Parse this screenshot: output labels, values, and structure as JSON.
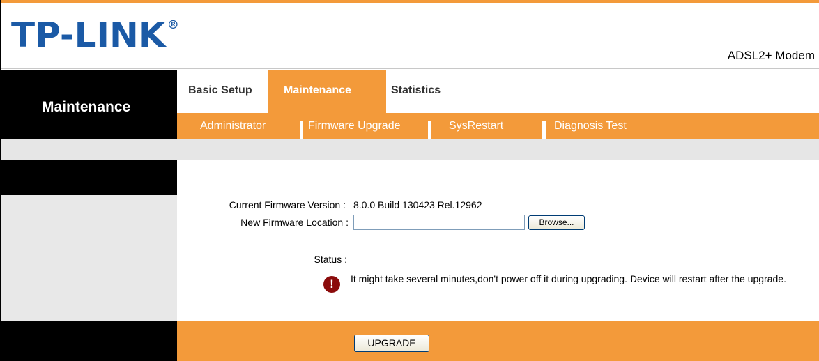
{
  "header": {
    "logo_text": "TP-LINK",
    "logo_mark": "®",
    "subtitle": "ADSL2+ Modem"
  },
  "sidebar": {
    "section_title": "Maintenance",
    "active_item": "Firmware Upgrade"
  },
  "nav": {
    "tabs": [
      {
        "label": "Basic Setup",
        "active": false
      },
      {
        "label": "Maintenance",
        "active": true
      },
      {
        "label": "Statistics",
        "active": false
      }
    ],
    "subtabs": [
      {
        "label": "Administrator"
      },
      {
        "label": "Firmware Upgrade"
      },
      {
        "label": "SysRestart"
      },
      {
        "label": "Diagnosis Test"
      }
    ]
  },
  "form": {
    "current_version_label": "Current Firmware Version :",
    "current_version_value": "8.0.0 Build 130423 Rel.12962",
    "new_location_label": "New Firmware Location :",
    "new_location_value": "",
    "browse_label": "Browse...",
    "status_label": "Status :",
    "warning_text": "It might take several minutes,don't power off it during upgrading. Device will restart after the upgrade.",
    "warning_icon": "!",
    "upgrade_label": "UPGRADE"
  },
  "colors": {
    "accent": "#f39a3a",
    "logo": "#1b5aa6",
    "warning_icon": "#8b0b0b"
  }
}
